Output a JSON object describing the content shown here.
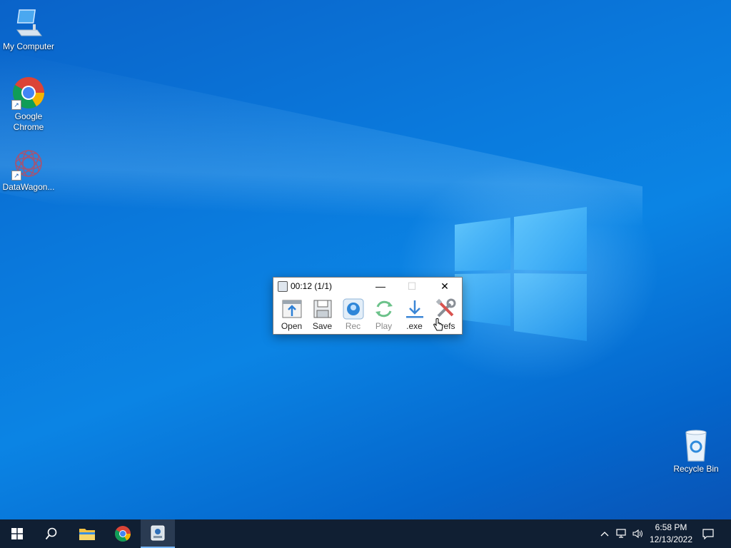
{
  "desktop": {
    "icons": [
      {
        "label": "My Computer"
      },
      {
        "label": "Google Chrome"
      },
      {
        "label": "DataWagon..."
      },
      {
        "label": "Recycle Bin"
      }
    ]
  },
  "window": {
    "title": "00:12 (1/1)",
    "controls": {
      "minimize": "—",
      "maximize": "☐",
      "close": "✕"
    },
    "toolbar": [
      {
        "label": "Open",
        "icon": "open-folder-icon",
        "enabled": true
      },
      {
        "label": "Save",
        "icon": "floppy-disk-icon",
        "enabled": true
      },
      {
        "label": "Rec",
        "icon": "record-icon",
        "enabled": false
      },
      {
        "label": "Play",
        "icon": "play-cycle-icon",
        "enabled": false
      },
      {
        "label": ".exe",
        "icon": "download-arrow-icon",
        "enabled": true
      },
      {
        "label": "Prefs",
        "icon": "tools-wrench-icon",
        "enabled": true
      }
    ]
  },
  "taskbar": {
    "clock_time": "6:58 PM",
    "clock_date": "12/13/2022"
  },
  "colors": {
    "taskbar": "#101f33",
    "accent": "#0078d7"
  }
}
